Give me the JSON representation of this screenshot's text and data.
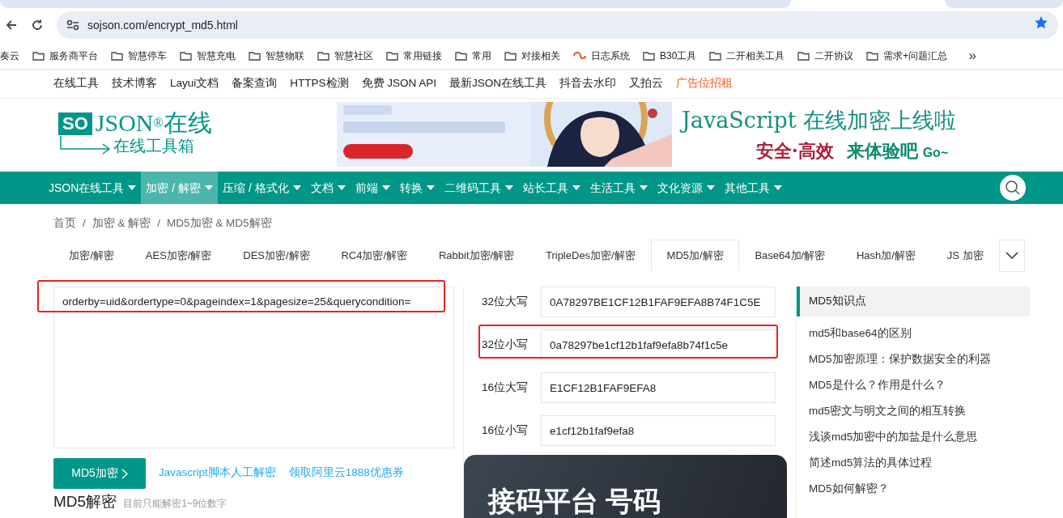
{
  "browser": {
    "url": "sojson.com/encrypt_md5.html",
    "bookmarks": [
      {
        "label": "奏云",
        "kind": "plain"
      },
      {
        "label": "服务商平台",
        "kind": "folder"
      },
      {
        "label": "智慧停车",
        "kind": "folder"
      },
      {
        "label": "智慧充电",
        "kind": "folder"
      },
      {
        "label": "智慧物联",
        "kind": "folder"
      },
      {
        "label": "智慧社区",
        "kind": "folder"
      },
      {
        "label": "常用链接",
        "kind": "folder"
      },
      {
        "label": "常用",
        "kind": "folder"
      },
      {
        "label": "对接相关",
        "kind": "folder"
      },
      {
        "label": "日志系统",
        "kind": "site"
      },
      {
        "label": "B30工具",
        "kind": "folder"
      },
      {
        "label": "二开相关工具",
        "kind": "folder"
      },
      {
        "label": "二开协议",
        "kind": "folder"
      },
      {
        "label": "需求+问题汇总",
        "kind": "folder"
      }
    ],
    "more": "»"
  },
  "top_links": [
    {
      "label": "在线工具",
      "kind": "plain"
    },
    {
      "label": "技术博客",
      "kind": "plain"
    },
    {
      "label": "Layui文档",
      "kind": "plain"
    },
    {
      "label": "备案查询",
      "kind": "plain"
    },
    {
      "label": "HTTPS检测",
      "kind": "plain"
    },
    {
      "label": "免费 JSON API",
      "kind": "plain"
    },
    {
      "label": "最新JSON在线工具",
      "kind": "plain"
    },
    {
      "label": "抖音去水印",
      "kind": "plain"
    },
    {
      "label": "又拍云",
      "kind": "plain"
    },
    {
      "label": "广告位招租",
      "kind": "promo"
    }
  ],
  "logo": {
    "badge": "SO",
    "name": "JSON",
    "mark": "®",
    "suffix": "在线",
    "tagline": "在线工具箱"
  },
  "promo": {
    "headline": "JavaScript 在线加密上线啦",
    "slogan": "安全·高效",
    "call": "来体验吧",
    "go": "Go~"
  },
  "nav": [
    {
      "label": "JSON在线工具",
      "selected": false
    },
    {
      "label": "加密 / 解密",
      "selected": true
    },
    {
      "label": "压缩 / 格式化",
      "selected": false
    },
    {
      "label": "文档",
      "selected": false
    },
    {
      "label": "前端",
      "selected": false
    },
    {
      "label": "转换",
      "selected": false
    },
    {
      "label": "二维码工具",
      "selected": false
    },
    {
      "label": "站长工具",
      "selected": false
    },
    {
      "label": "生活工具",
      "selected": false
    },
    {
      "label": "文化资源",
      "selected": false
    },
    {
      "label": "其他工具",
      "selected": false
    }
  ],
  "breadcrumb": {
    "separator": "/",
    "items": [
      "首页",
      "加密 & 解密",
      "MD5加密 & MD5解密"
    ]
  },
  "tabs": [
    {
      "label": "加密/解密",
      "selected": false
    },
    {
      "label": "AES加密/解密",
      "selected": false
    },
    {
      "label": "DES加密/解密",
      "selected": false
    },
    {
      "label": "RC4加密/解密",
      "selected": false
    },
    {
      "label": "Rabbit加密/解密",
      "selected": false
    },
    {
      "label": "TripleDes加密/解密",
      "selected": false
    },
    {
      "label": "MD5加/解密",
      "selected": true
    },
    {
      "label": "Base64加/解密",
      "selected": false
    },
    {
      "label": "Hash加/解密",
      "selected": false
    },
    {
      "label": "JS 加密",
      "selected": false
    }
  ],
  "input": {
    "value": "orderby=uid&ordertype=0&pageindex=1&pagesize=25&querycondition=",
    "highlighted": true
  },
  "results": [
    {
      "label": "32位大写",
      "value": "0A78297BE1CF12B1FAF9EFA8B74F1C5E",
      "highlighted": false
    },
    {
      "label": "32位小写",
      "value": "0a78297be1cf12b1faf9efa8b74f1c5e",
      "highlighted": true
    },
    {
      "label": "16位大写",
      "value": "E1CF12B1FAF9EFA8",
      "highlighted": false
    },
    {
      "label": "16位小写",
      "value": "e1cf12b1faf9efa8",
      "highlighted": false
    }
  ],
  "encrypt_button": "MD5加密",
  "links": [
    "Javascript脚本人工解密",
    "领取阿里云1888优惠券"
  ],
  "decrypt": {
    "title": "MD5解密",
    "note": "目前只能解密1~9位数字"
  },
  "ad_card": {
    "text": "接码平台 号码"
  },
  "sidebar": {
    "title": "MD5知识点",
    "items": [
      "md5和base64的区别",
      "MD5加密原理：保护数据安全的利器",
      "MD5是什么？作用是什么？",
      "md5密文与明文之间的相互转换",
      "浅谈md5加密中的加盐是什么意思",
      "简述md5算法的具体过程",
      "MD5如何解密？"
    ]
  }
}
